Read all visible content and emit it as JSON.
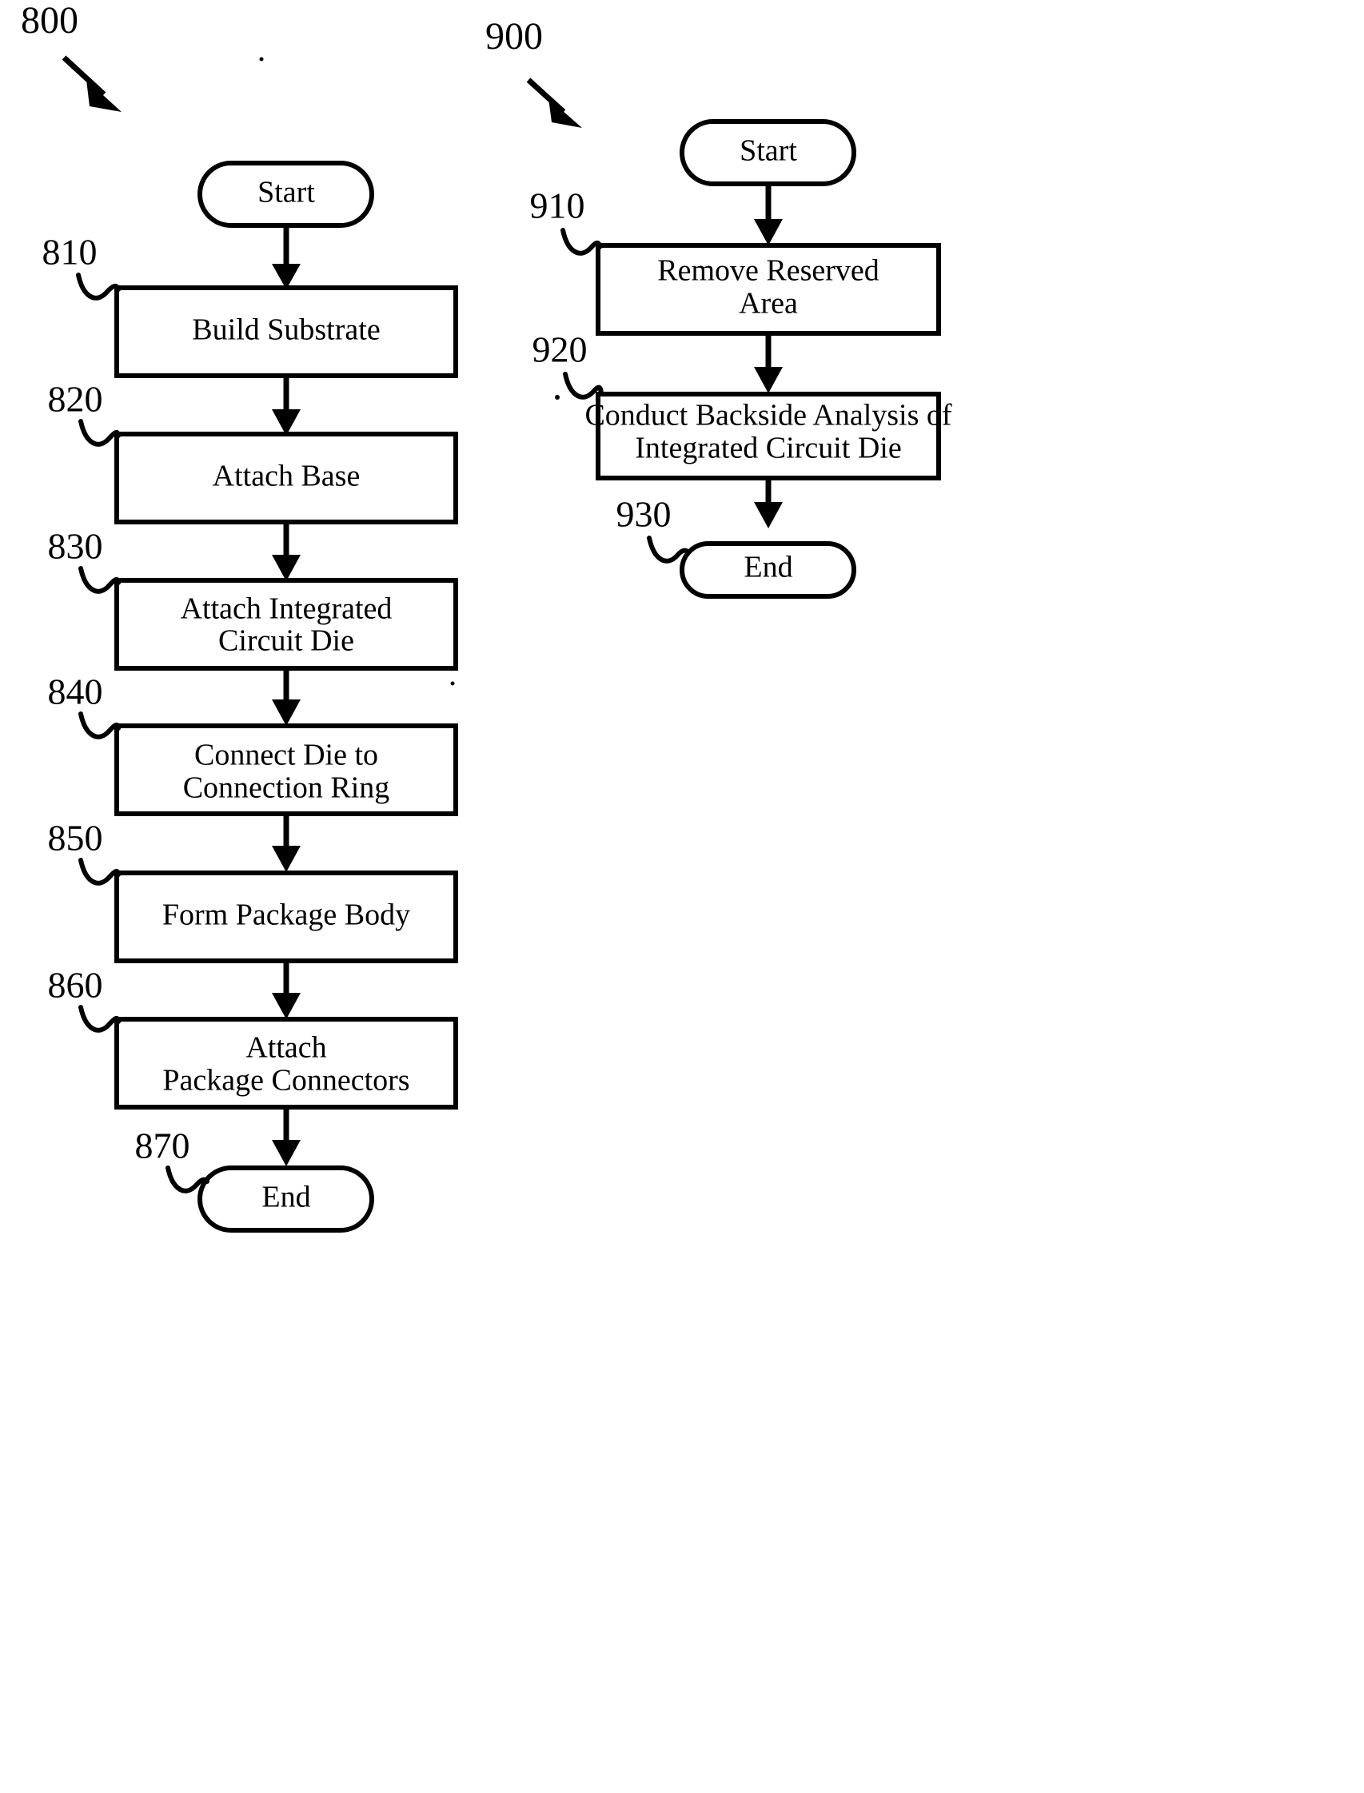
{
  "figures": [
    {
      "id": "fig-800",
      "ref_label": "800",
      "nodes": [
        {
          "key": "start",
          "type": "terminator",
          "label": "Start",
          "ref": null
        },
        {
          "key": "build_substrate",
          "type": "process",
          "label_line1": "Build Substrate",
          "label_line2": "",
          "ref": "810"
        },
        {
          "key": "attach_base",
          "type": "process",
          "label_line1": "Attach Base",
          "label_line2": "",
          "ref": "820"
        },
        {
          "key": "attach_ic_die",
          "type": "process",
          "label_line1": "Attach Integrated",
          "label_line2": "Circuit Die",
          "ref": "830"
        },
        {
          "key": "connect_die",
          "type": "process",
          "label_line1": "Connect Die to",
          "label_line2": "Connection Ring",
          "ref": "840"
        },
        {
          "key": "form_package_body",
          "type": "process",
          "label_line1": "Form Package Body",
          "label_line2": "",
          "ref": "850"
        },
        {
          "key": "attach_connectors",
          "type": "process",
          "label_line1": "Attach",
          "label_line2": "Package Connectors",
          "ref": "860"
        },
        {
          "key": "end",
          "type": "terminator",
          "label": "End",
          "ref": "870"
        }
      ]
    },
    {
      "id": "fig-900",
      "ref_label": "900",
      "nodes": [
        {
          "key": "start",
          "type": "terminator",
          "label": "Start",
          "ref": null
        },
        {
          "key": "remove_reserved_area",
          "type": "process",
          "label_line1": "Remove Reserved",
          "label_line2": "Area",
          "ref": "910"
        },
        {
          "key": "conduct_backside_analysis",
          "type": "process",
          "label_line1": "Conduct Backside Analysis of",
          "label_line2": "Integrated Circuit Die",
          "ref": "920"
        },
        {
          "key": "end",
          "type": "terminator",
          "label": "End",
          "ref": "930"
        }
      ]
    }
  ],
  "colors": {
    "stroke": "#000000",
    "fill": "#ffffff",
    "background": "#ffffff"
  }
}
